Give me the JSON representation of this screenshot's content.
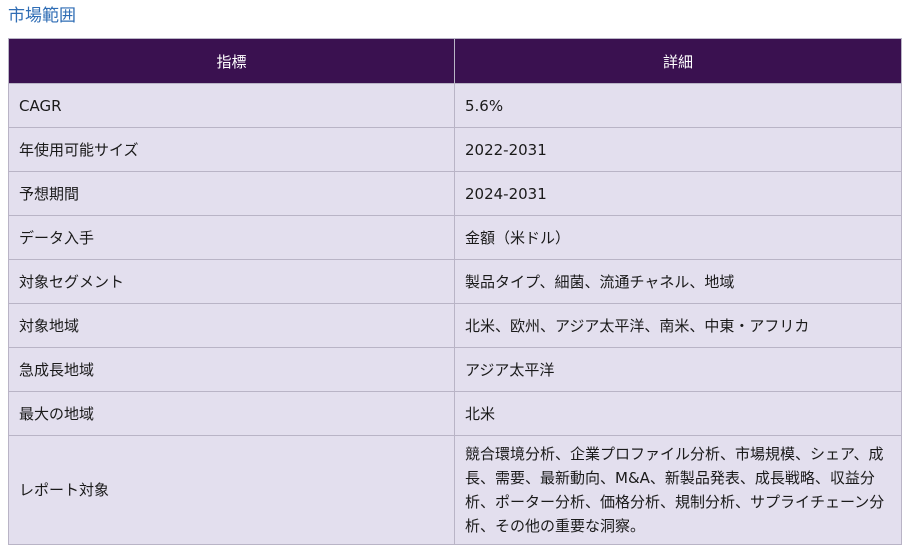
{
  "section_title": "市場範囲",
  "table": {
    "headers": [
      "指標",
      "詳細"
    ],
    "rows": [
      [
        "CAGR",
        "5.6%"
      ],
      [
        "年使用可能サイズ",
        "2022-2031"
      ],
      [
        "予想期間",
        "2024-2031"
      ],
      [
        "データ入手",
        "金額（米ドル）"
      ],
      [
        "対象セグメント",
        "製品タイプ、細菌、流通チャネル、地域"
      ],
      [
        "対象地域",
        "北米、欧州、アジア太平洋、南米、中東・アフリカ"
      ],
      [
        "急成長地域",
        "アジア太平洋"
      ],
      [
        "最大の地域",
        "北米"
      ],
      [
        "レポート対象",
        "競合環境分析、企業プロファイル分析、市場規模、シェア、成長、需要、最新動向、M&A、新製品発表、成長戦略、収益分析、ポーター分析、価格分析、規制分析、サプライチェーン分析、その他の重要な洞察。"
      ]
    ]
  }
}
